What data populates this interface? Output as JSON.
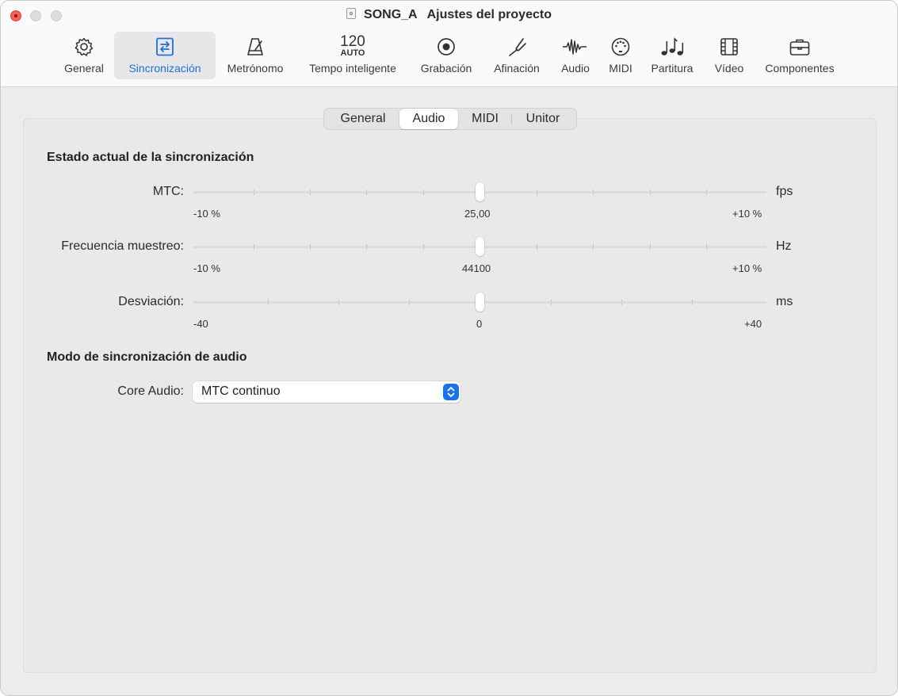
{
  "window": {
    "title": "SONG_A",
    "subtitle": "Ajustes del proyecto"
  },
  "toolbar": {
    "items": [
      {
        "label": "General",
        "icon": "gear-icon"
      },
      {
        "label": "Sincronización",
        "icon": "sync-icon",
        "selected": true
      },
      {
        "label": "Metrónomo",
        "icon": "metronome-icon"
      },
      {
        "label": "Tempo inteligente",
        "icon": "smart-tempo-icon",
        "bpm": "120",
        "mode": "AUTO"
      },
      {
        "label": "Grabación",
        "icon": "record-icon"
      },
      {
        "label": "Afinación",
        "icon": "tuning-fork-icon"
      },
      {
        "label": "Audio",
        "icon": "waveform-icon"
      },
      {
        "label": "MIDI",
        "icon": "midi-port-icon"
      },
      {
        "label": "Partitura",
        "icon": "notes-icon"
      },
      {
        "label": "Vídeo",
        "icon": "film-icon"
      },
      {
        "label": "Componentes",
        "icon": "briefcase-icon"
      }
    ]
  },
  "subtabs": {
    "items": [
      "General",
      "Audio",
      "MIDI",
      "Unitor"
    ],
    "selected": "Audio"
  },
  "sync_status": {
    "heading": "Estado actual de la sincronización",
    "rows": [
      {
        "label": "MTC:",
        "unit": "fps",
        "min": "-10 %",
        "center": "25,00",
        "max": "+10 %",
        "position": 0.5
      },
      {
        "label": "Frecuencia muestreo:",
        "unit": "Hz",
        "min": "-10 %",
        "center": "44100",
        "max": "+10 %",
        "position": 0.5
      },
      {
        "label": "Desviación:",
        "unit": "ms",
        "min": "-40",
        "center": "0",
        "max": "+40",
        "position": 0.5
      }
    ]
  },
  "audio_sync_mode": {
    "heading": "Modo de sincronización de audio",
    "core_audio_label": "Core Audio:",
    "core_audio_value": "MTC continuo"
  },
  "colors": {
    "accent": "#1a73e8",
    "close_button": "#ff5f57"
  }
}
